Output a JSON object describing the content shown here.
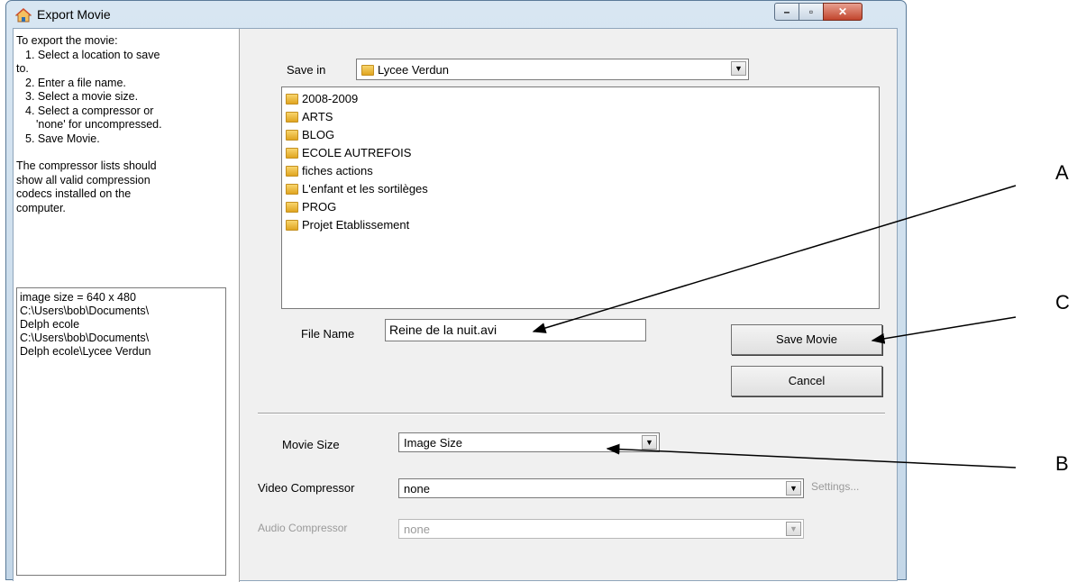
{
  "window": {
    "title": "Export Movie",
    "icon": "house-icon"
  },
  "instructions": {
    "heading": "To export the movie:",
    "steps": [
      "1. Select a location to save",
      "to.",
      "2. Enter a file name.",
      "3. Select a movie size.",
      "4. Select a compressor or",
      "'none' for uncompressed.",
      "5. Save Movie."
    ],
    "note": [
      "The compressor lists should",
      "show all valid compression",
      "codecs installed on the",
      "computer."
    ]
  },
  "log": {
    "lines": [
      "image size = 640 x 480",
      "C:\\Users\\bob\\Documents\\",
      "Delph ecole",
      "C:\\Users\\bob\\Documents\\",
      "Delph ecole\\Lycee Verdun"
    ]
  },
  "save_in": {
    "label": "Save in",
    "value": "Lycee Verdun"
  },
  "folders": [
    "2008-2009",
    "ARTS",
    "BLOG",
    "ECOLE AUTREFOIS",
    "fiches actions",
    "L'enfant et les sortilèges",
    "PROG",
    "Projet Etablissement"
  ],
  "file_name": {
    "label": "File Name",
    "value": "Reine de la nuit.avi"
  },
  "buttons": {
    "save": "Save Movie",
    "cancel": "Cancel"
  },
  "movie_size": {
    "label": "Movie Size",
    "value": "Image Size"
  },
  "video_compressor": {
    "label": "Video Compressor",
    "value": "none",
    "settings": "Settings..."
  },
  "audio_compressor": {
    "label": "Audio Compressor",
    "value": "none"
  },
  "annotations": [
    "A",
    "C",
    "B"
  ]
}
